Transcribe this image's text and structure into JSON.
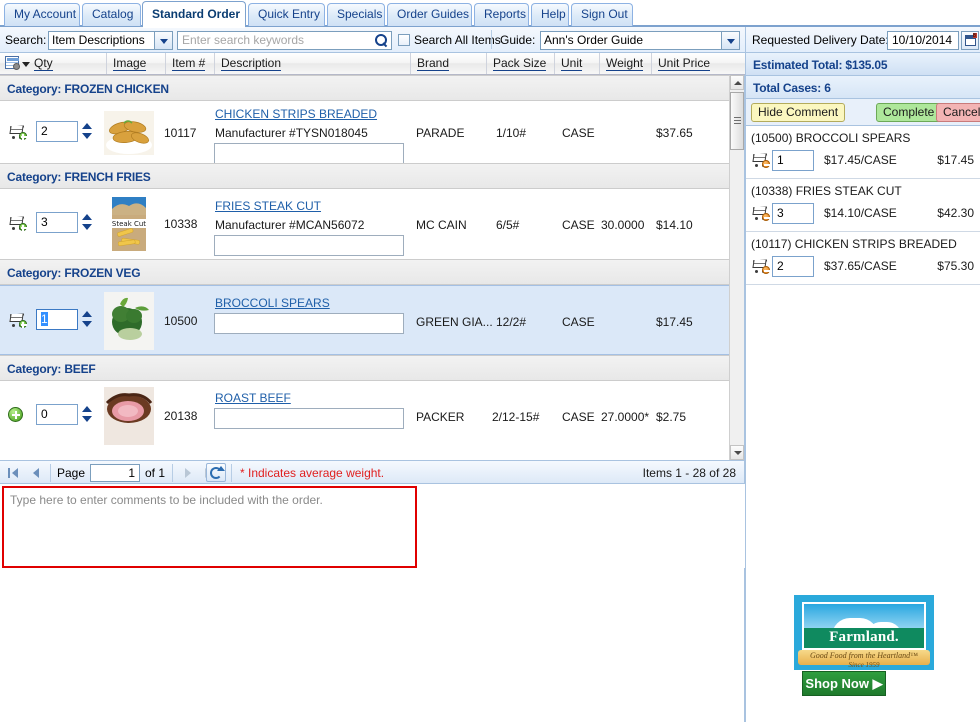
{
  "tabs": [
    {
      "label": "My Account",
      "active": false
    },
    {
      "label": "Catalog",
      "active": false
    },
    {
      "label": "Standard Order",
      "active": true
    },
    {
      "label": "Quick Entry",
      "active": false
    },
    {
      "label": "Specials",
      "active": false
    },
    {
      "label": "Order Guides",
      "active": false
    },
    {
      "label": "Reports",
      "active": false
    },
    {
      "label": "Help",
      "active": false
    },
    {
      "label": "Sign Out",
      "active": false
    }
  ],
  "search": {
    "label": "Search:",
    "scope_value": "Item Descriptions",
    "keywords_value": "",
    "keywords_placeholder": "Enter search keywords",
    "search_all_label": "Search All Items",
    "search_all_checked": false,
    "guide_label": "Guide:",
    "guide_value": "Ann's Order Guide"
  },
  "delivery": {
    "label": "Requested Delivery Date:",
    "value": "10/10/2014"
  },
  "grid": {
    "columns": [
      "Qty",
      "Image",
      "Item #",
      "Description",
      "Brand",
      "Pack Size",
      "Unit",
      "Weight",
      "Unit Price"
    ],
    "rows": [
      {
        "kind": "category",
        "label": "Category: FROZEN CHICKEN"
      },
      {
        "kind": "item",
        "selected": false,
        "cart_state": "add",
        "qty": "2",
        "qty_selected": false,
        "item_no": "10117",
        "description": "CHICKEN STRIPS BREADED",
        "manufacturer": "Manufacturer #TYSN018045",
        "note": "",
        "brand": "PARADE",
        "pack_size": "1/10#",
        "unit": "CASE",
        "weight": "",
        "unit_price": "$37.65",
        "image": "chicken-strips"
      },
      {
        "kind": "category",
        "label": "Category: FRENCH FRIES"
      },
      {
        "kind": "item",
        "selected": false,
        "cart_state": "add",
        "qty": "3",
        "qty_selected": false,
        "item_no": "10338",
        "description": "FRIES STEAK CUT",
        "manufacturer": "Manufacturer #MCAN56072",
        "note": "",
        "brand": "MC CAIN",
        "pack_size": "6/5#",
        "unit": "CASE",
        "weight": "30.0000",
        "unit_price": "$14.10",
        "image": "fries-bag"
      },
      {
        "kind": "category",
        "label": "Category: FROZEN VEG"
      },
      {
        "kind": "item",
        "selected": true,
        "cart_state": "add",
        "qty": "1",
        "qty_selected": true,
        "item_no": "10500",
        "description": "BROCCOLI SPEARS",
        "manufacturer": "",
        "note": "",
        "brand": "GREEN GIA...",
        "pack_size": "12/2#",
        "unit": "CASE",
        "weight": "",
        "unit_price": "$17.45",
        "image": "broccoli"
      },
      {
        "kind": "category",
        "label": "Category: BEEF"
      },
      {
        "kind": "item",
        "selected": false,
        "cart_state": "plus",
        "qty": "0",
        "qty_selected": false,
        "item_no": "20138",
        "description": "ROAST BEEF",
        "manufacturer": "",
        "note": "",
        "brand": "PACKER",
        "pack_size": "2/12-15#",
        "unit": "CASE",
        "weight": "27.0000*",
        "unit_price": "$2.75",
        "image": "roast-beef"
      }
    ]
  },
  "pager": {
    "page_label": "Page",
    "page_value": "1",
    "of_label": "of 1",
    "avg_weight_note": "* Indicates average weight.",
    "item_count": "Items 1 - 28 of 28"
  },
  "comment": {
    "placeholder": "Type here to enter comments to be included with the order.",
    "value": ""
  },
  "right_panel": {
    "estimated_total": "Estimated Total: $135.05",
    "total_cases": "Total Cases: 6",
    "hide_comment_label": "Hide Comment",
    "complete_label": "Complete",
    "cancel_label": "Cancel",
    "cart_items": [
      {
        "name": "(10500) BROCCOLI SPEARS",
        "qty": "1",
        "unit_price": "$17.45/CASE",
        "extended": "$17.45"
      },
      {
        "name": "(10338) FRIES STEAK CUT",
        "qty": "3",
        "unit_price": "$14.10/CASE",
        "extended": "$42.30"
      },
      {
        "name": "(10117) CHICKEN STRIPS BREADED",
        "qty": "2",
        "unit_price": "$37.65/CASE",
        "extended": "$75.30"
      }
    ],
    "ad": {
      "brand": "Farmland.",
      "tagline": "Good Food from the Heartland™",
      "since": "Since 1959",
      "shop_now_label": "Shop Now ▶"
    }
  },
  "colors": {
    "accent_blue": "#15428b",
    "tab_active_bg": "#ffffff",
    "selected_row": "#dbe8f8",
    "link": "#1f5fa9",
    "warn_red": "#e02020",
    "complete_green": "#aee79b",
    "cancel_red": "#f3b4b4",
    "comment_yellow": "#fbf7c0"
  }
}
